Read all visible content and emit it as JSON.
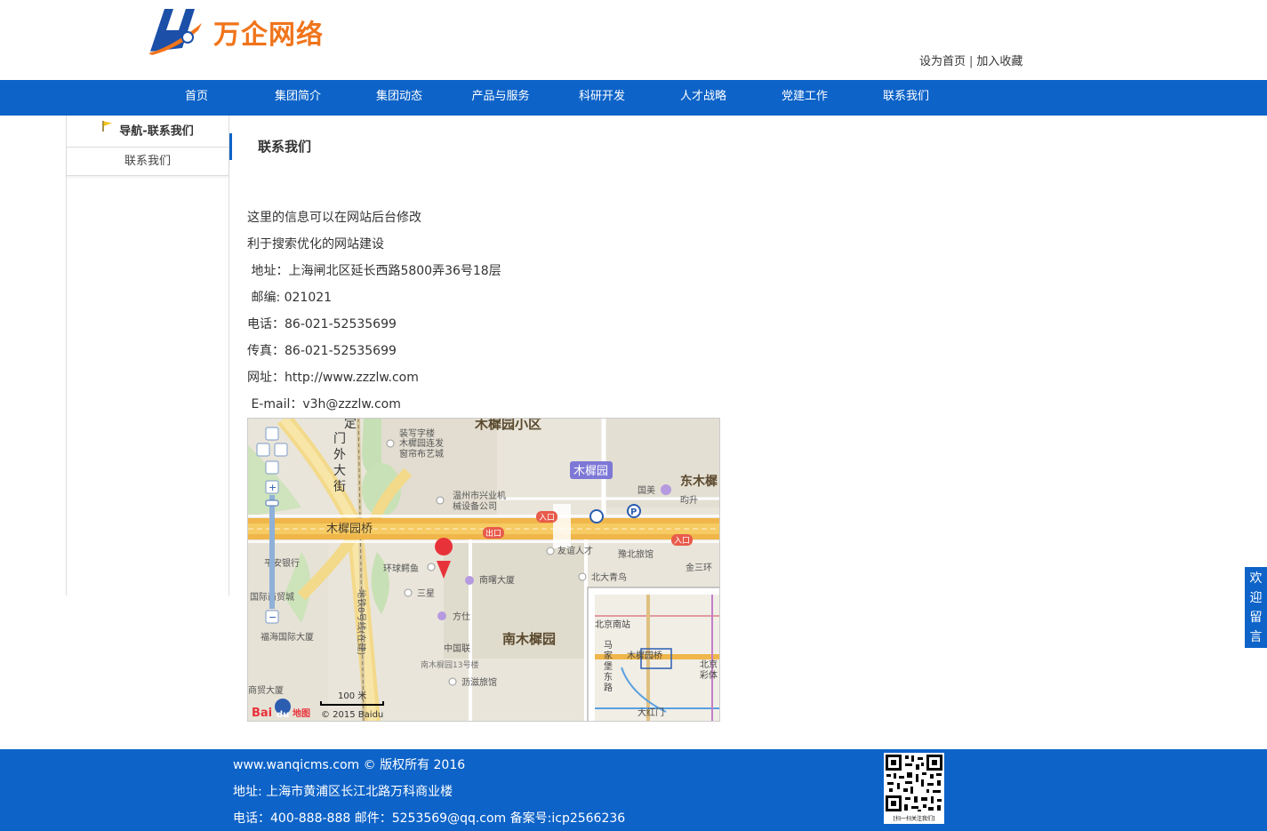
{
  "header": {
    "logo_text": "万企网络",
    "links": [
      "设为首页",
      "加入收藏"
    ],
    "separator": "|"
  },
  "nav": {
    "items": [
      "首页",
      "集团简介",
      "集团动态",
      "产品与服务",
      "科研开发",
      "人才战略",
      "党建工作",
      "联系我们"
    ]
  },
  "sidebar": {
    "title": "导航-联系我们",
    "items": [
      "联系我们"
    ]
  },
  "content": {
    "title": "联系我们",
    "lines": [
      "这里的信息可以在网站后台修改",
      "利于搜索优化的网站建设",
      " 地址：上海闸北区延长西路5800弄36号18层",
      " 邮编: 021021",
      "电话：86-021-52535699",
      "传真：86-021-52535699",
      "网址：http://www.zzzlw.com",
      " E-mail：v3h@zzzlw.com"
    ]
  },
  "map": {
    "labels": {
      "xiaoqu": "木樨园小区",
      "zhuangxie": "装写字楼",
      "lianfa": "木樨园连发",
      "bufen": "窗帘布艺城",
      "wenzhou": "温州市兴业机",
      "jixie": "械设备公司",
      "muxiyuan_badge": "木樨园",
      "guomei": "国美",
      "dongmuxi": "东木樨",
      "jiongsheng": "昀升",
      "road": "木樨园桥",
      "road_v1": "定",
      "road_v2": "门",
      "road_v3": "外",
      "road_v4": "大",
      "road_v5": "街",
      "ruko1": "入口",
      "chuko": "出口",
      "ruko2": "入口",
      "pingan": "平安银行",
      "huanqiu": "环球鳄鱼",
      "youyi": "友谊人才",
      "yubei": "豫北旅馆",
      "jinsan": "金三环",
      "nanshu": "南曙大厦",
      "beidaqing": "北大青鸟",
      "guoji": "国际商贸城",
      "sanxing": "三星",
      "fangshi": "方仕",
      "metro": "地铁8号线(在建)",
      "fuhai": "福海国际大厦",
      "nanmuxiyuan": "南木樨园",
      "zhongguolian": "中国联",
      "nan13": "南木樨园13号楼",
      "lilv": "沥滋旅馆",
      "shangmao": "商贸大厦",
      "scale": "100 米",
      "copyright": "© 2015 Baidu",
      "baidu": "Bai",
      "baidu2": "du",
      "baidu3": "地图",
      "ov_beijingnan": "北京南站",
      "ov_majiabao": "马家堡东路",
      "ov_muxiyuanqiao": "木樨园桥",
      "ov_beijing2": "北京",
      "ov_caiti": "彩体",
      "ov_dahongmen": "大红门"
    }
  },
  "message_tab": [
    "欢",
    "迎",
    "留",
    "言"
  ],
  "footer": {
    "line1": "www.wanqicms.com © 版权所有 2016",
    "line2": "地址: 上海市黄浦区长江北路万科商业楼",
    "line3": "电话：400-888-888 邮件：5253569@qq.com 备案号:icp2566236",
    "qr_caption": "[扫一扫关注我们]"
  },
  "colors": {
    "brand_blue": "#0d63c8",
    "logo_orange": "#f0741b"
  }
}
